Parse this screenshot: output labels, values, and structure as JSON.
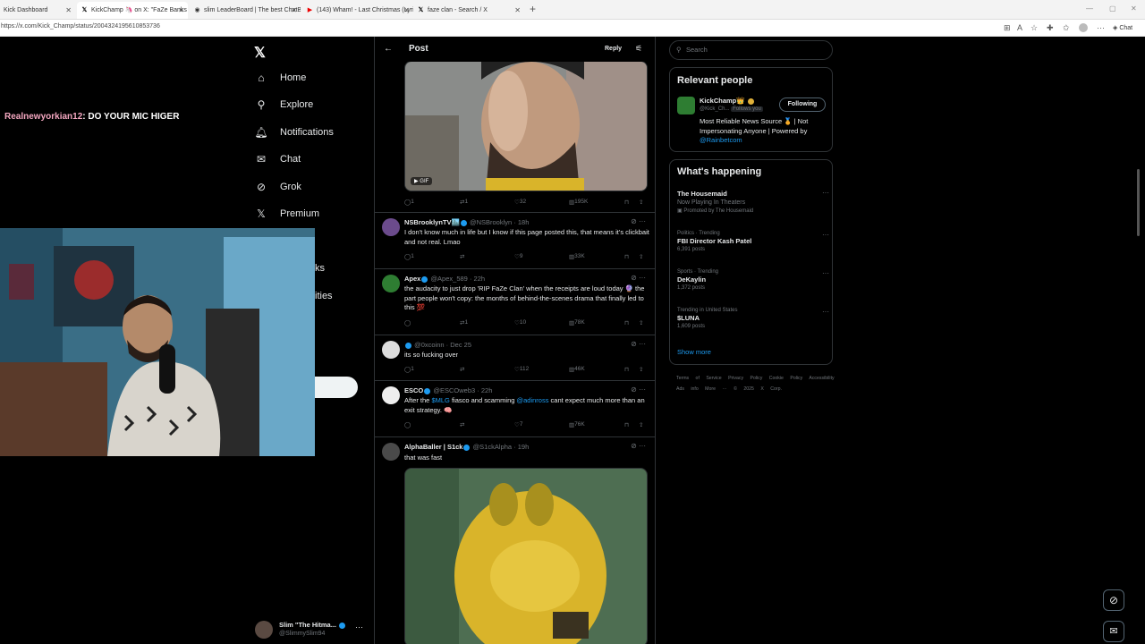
{
  "browser": {
    "tabs": [
      {
        "label": "Kick Dashboard",
        "active": false
      },
      {
        "label": "KickChamp 🦄 on X: \"FaZe Banks",
        "active": true
      },
      {
        "label": "slim LeaderBoard | The best ChatB",
        "active": false
      },
      {
        "label": "(143) Wham! - Last Christmas (Lyri",
        "active": false
      },
      {
        "label": "faze clan - Search / X",
        "active": false
      }
    ],
    "url": "https://x.com/Kick_Champ/status/2004324195610853736",
    "chat_button": "Chat"
  },
  "sidebar": {
    "items": [
      {
        "label": "Home",
        "icon": "home-icon"
      },
      {
        "label": "Explore",
        "icon": "search-icon"
      },
      {
        "label": "Notifications",
        "icon": "bell-icon"
      },
      {
        "label": "Chat",
        "icon": "mail-icon"
      },
      {
        "label": "Grok",
        "icon": "grok-icon"
      },
      {
        "label": "Premium",
        "icon": "x-icon"
      }
    ],
    "partial_items": [
      "ks",
      "ities"
    ],
    "account": {
      "name": "Slim \"The Hitma...",
      "handle": "@SlimmySlim94"
    }
  },
  "overlay": {
    "chat_user": "Realnewyorkian12",
    "chat_message": ": DO YOUR MIC HIGER"
  },
  "post": {
    "header_title": "Post",
    "reply_button": "Reply",
    "gif_badge": "GIF",
    "stats": {
      "replies": "1",
      "reposts": "1",
      "likes": "32",
      "views": "195K"
    }
  },
  "replies": [
    {
      "name": "NSBrooklynTV🏙️",
      "handle": "@NSBrooklyn",
      "time": "· 18h",
      "text": "I don't know much in life but I know if this page posted this, that means it's clickbait and not real. Lmao",
      "stats": {
        "replies": "1",
        "reposts": "",
        "likes": "9",
        "views": "33K"
      }
    },
    {
      "name": "Apex",
      "handle": "@Apex_589",
      "time": "· 22h",
      "text": "the audacity to just drop 'RIP FaZe Clan' when the receipts are loud today 🔮 the part people won't copy: the months of behind-the-scenes drama that finally led to this 💯",
      "stats": {
        "replies": "",
        "reposts": "1",
        "likes": "10",
        "views": "78K"
      }
    },
    {
      "name": "",
      "handle": "@0xcoinn",
      "time": "· Dec 25",
      "text": "its so fucking over",
      "stats": {
        "replies": "1",
        "reposts": "",
        "likes": "112",
        "views": "46K"
      }
    },
    {
      "name": "ESCO",
      "handle": "@ESCOweb3",
      "time": "· 22h",
      "text_pre": "After the ",
      "text_link1": "$MLG",
      "text_mid": " fiasco and scamming ",
      "text_link2": "@adinross",
      "text_post": " cant expect much more than an exit strategy. 🧠",
      "stats": {
        "replies": "",
        "reposts": "",
        "likes": "7",
        "views": "76K"
      }
    },
    {
      "name": "AlphaBaller | S1ck",
      "handle": "@S1ckAlpha",
      "time": "· 19h",
      "text": "that was fast"
    }
  ],
  "right": {
    "search_placeholder": "Search",
    "relevant_title": "Relevant people",
    "person": {
      "name": "KickChamp👑",
      "handle": "@Kick_Ch...",
      "follows_badge": "Follows you",
      "follow_button": "Following",
      "bio_pre": "Most Reliable News Source 🏅 | Not Impersonating Anyone | Powered by ",
      "bio_link": "@Rainbetcom"
    },
    "happening_title": "What's happening",
    "trends": [
      {
        "context": "",
        "name": "The Housemaid",
        "subtitle": "Now Playing In Theaters",
        "count": "Promoted by The Housemaid"
      },
      {
        "context": "Politics · Trending",
        "name": "FBI Director Kash Patel",
        "subtitle": "",
        "count": "6,391 posts"
      },
      {
        "context": "Sports · Trending",
        "name": "DeKaylin",
        "subtitle": "",
        "count": "1,372 posts"
      },
      {
        "context": "Trending in United States",
        "name": "$LUNA",
        "subtitle": "",
        "count": "1,609 posts"
      }
    ],
    "show_more": "Show more",
    "footer": "Terms of Service  Privacy Policy  Cookie Policy  Accessibility  Ads info  More ···  © 2025 X Corp."
  },
  "colors": {
    "accent": "#1d9bf0",
    "border": "#2f3336",
    "muted": "#71767b",
    "gif_yellow": "#d9b42a"
  }
}
